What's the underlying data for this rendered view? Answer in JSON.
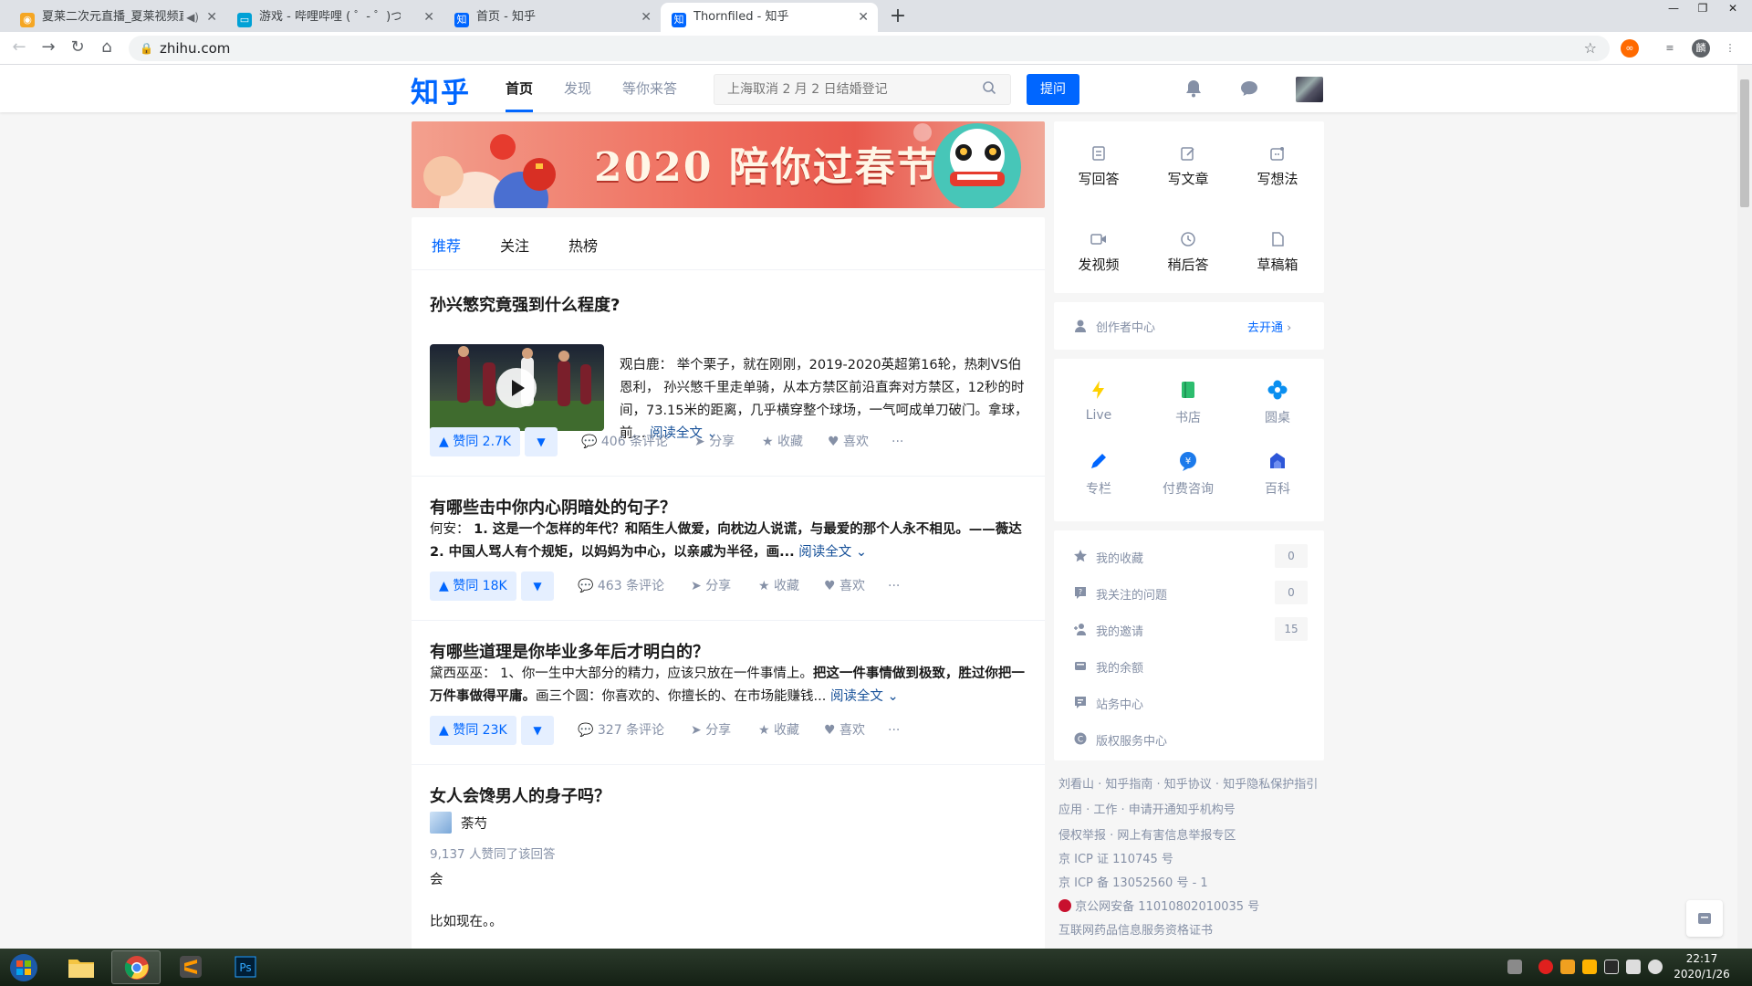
{
  "browser": {
    "tabs": [
      {
        "title": "夏莱二次元直播_夏莱视频直",
        "favicon": "video-icon",
        "favicon_color": "#f5a623",
        "has_audio": true
      },
      {
        "title": "游戏 - 哔哩哔哩 ( ゜- ゜)つロ 干杯",
        "favicon": "bilibili-icon",
        "favicon_color": "#00a1d6",
        "has_audio": false
      },
      {
        "title": "首页 - 知乎",
        "favicon": "zhihu-icon",
        "favicon_color": "#0066ff",
        "has_audio": false
      },
      {
        "title": "Thornfiled - 知乎",
        "favicon": "zhihu-icon",
        "favicon_color": "#0066ff",
        "has_audio": false
      }
    ],
    "active_tab": 3,
    "url": "zhihu.com",
    "new_tab_symbol": "+",
    "close_symbol": "✕",
    "profile_initial": "麟"
  },
  "header": {
    "logo": "知乎",
    "nav": [
      "首页",
      "发现",
      "等你来答"
    ],
    "active_nav": 0,
    "search_placeholder": "上海取消 2 月 2 日结婚登记",
    "ask_button": "提问",
    "brand_color": "#0066ff"
  },
  "banner": {
    "text": "2020 陪你过春节"
  },
  "feed": {
    "tabs": [
      "推荐",
      "关注",
      "热榜"
    ],
    "active_tab": 0,
    "items": [
      {
        "question": "孙兴慜究竟强到什么程度?",
        "excerpt": "观白鹿： 举个栗子，就在刚刚，2019-2020英超第16轮，热刺VS伯恩利， 孙兴慜千里走单骑，从本方禁区前沿直奔对方禁区，12秒的时间，73.15米的距离，几乎横穿整个球场，一气呵成单刀破门。拿球，前...",
        "read_more": "阅读全文",
        "vote": "赞同 2.7K",
        "comments": "406 条评论",
        "share": "分享",
        "favorite": "收藏",
        "like": "喜欢",
        "more": "···"
      },
      {
        "question": "有哪些击中你内心阴暗处的句子？",
        "author": "何安：",
        "excerpt": "1. 这是一个怎样的年代？和陌生人做爱，向枕边人说谎，与最爱的那个人永不相见。——薇达 2. 中国人骂人有个规矩，以妈妈为中心，以亲戚为半径，画...",
        "read_more": "阅读全文",
        "vote": "赞同 18K",
        "comments": "463 条评论",
        "share": "分享",
        "favorite": "收藏",
        "like": "喜欢",
        "more": "···"
      },
      {
        "question": "有哪些道理是你毕业多年后才明白的？",
        "author": "黛西巫巫：",
        "excerpt_normal": "1、你一生中大部分的精力，应该只放在一件事情上。",
        "excerpt_bold": "把这一件事情做到极致，胜过你把一万件事做得平庸。",
        "excerpt_tail": "画三个圆：你喜欢的、你擅长的、在市场能赚钱...",
        "read_more": "阅读全文",
        "vote": "赞同 23K",
        "comments": "327 条评论",
        "share": "分享",
        "favorite": "收藏",
        "like": "喜欢",
        "more": "···"
      },
      {
        "question": "女人会馋男人的身子吗？",
        "author_name": "荼芍",
        "upvote_note": "9,137 人赞同了该回答",
        "line1": "会",
        "line2": "比如现在。。"
      }
    ]
  },
  "sidebar": {
    "write": [
      "写回答",
      "写文章",
      "写想法",
      "发视频",
      "稍后答",
      "草稿箱"
    ],
    "creator": {
      "label": "创作者中心",
      "action": "去开通"
    },
    "apps": [
      {
        "label": "Live",
        "icon": "lightning-icon",
        "color": "#ffd100"
      },
      {
        "label": "书店",
        "icon": "book-icon",
        "color": "#2dbd6e"
      },
      {
        "label": "圆桌",
        "icon": "roundtable-icon",
        "color": "#0a8ff0"
      },
      {
        "label": "专栏",
        "icon": "pen-icon",
        "color": "#0066ff"
      },
      {
        "label": "付费咨询",
        "icon": "consult-icon",
        "color": "#1c7aeb"
      },
      {
        "label": "百科",
        "icon": "baike-icon",
        "color": "#2e57d8"
      }
    ],
    "menu": [
      {
        "label": "我的收藏",
        "count": "0",
        "icon": "star-icon"
      },
      {
        "label": "我关注的问题",
        "count": "0",
        "icon": "question-icon"
      },
      {
        "label": "我的邀请",
        "count": "15",
        "icon": "invite-icon"
      },
      {
        "label": "我的余额",
        "count": "",
        "icon": "wallet-icon"
      },
      {
        "label": "站务中心",
        "count": "",
        "icon": "service-icon"
      },
      {
        "label": "版权服务中心",
        "count": "",
        "icon": "copyright-icon"
      }
    ],
    "footer": [
      "刘看山 · 知乎指南 · 知乎协议 · 知乎隐私保护指引",
      "应用 · 工作 · 申请开通知乎机构号",
      "侵权举报 · 网上有害信息举报专区",
      "京 ICP 证 110745 号",
      "京 ICP 备 13052560 号 - 1",
      "京公网安备 11010802010035 号",
      "互联网药品信息服务资格证书"
    ]
  },
  "taskbar": {
    "time": "22:17",
    "date": "2020/1/26"
  }
}
